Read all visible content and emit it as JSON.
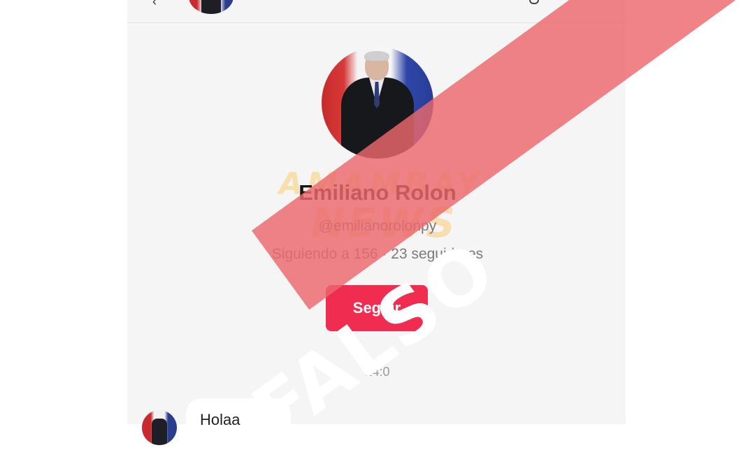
{
  "profile": {
    "name": "Emiliano Rolon",
    "handle": "@emilianorolonpy",
    "stats": "Siguiendo a 156 · 23 seguidores",
    "follow_label": "Seguir"
  },
  "chat": {
    "timestamp": "14:0",
    "message": "Holaa"
  },
  "watermark": {
    "line1": "AMAMBAY",
    "line2": "NEWS"
  },
  "stamp": {
    "label": "FALSO",
    "color": "#ec686c"
  },
  "colors": {
    "follow_button": "#f02c50",
    "panel_background": "#f5f5f5"
  }
}
